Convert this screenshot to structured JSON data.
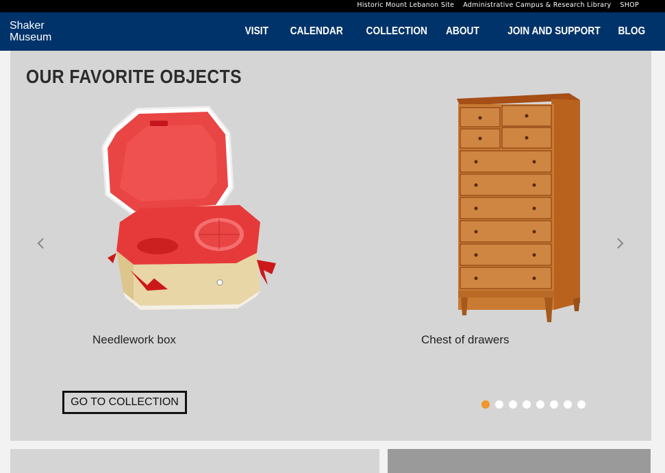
{
  "topbar": {
    "links": [
      "Historic Mount Lebanon Site",
      "Administrative Campus & Research Library",
      "SHOP"
    ]
  },
  "header": {
    "logo_line1": "Shaker",
    "logo_line2": "Museum",
    "nav": [
      "VISIT",
      "CALENDAR",
      "COLLECTION",
      "ABOUT",
      "JOIN AND SUPPORT",
      "BLOG"
    ]
  },
  "feature": {
    "title": "OUR FAVORITE OBJECTS",
    "slides": [
      {
        "caption": "Needlework box",
        "icon": "needlework-box-image"
      },
      {
        "caption": "Chest of drawers",
        "icon": "chest-of-drawers-image"
      }
    ],
    "prev_icon": "chevron-left-icon",
    "next_icon": "chevron-right-icon",
    "button_label": "GO TO COLLECTION",
    "dots_total": 8,
    "dots_active": 1
  },
  "colors": {
    "nav_bg": "#00336a",
    "topbar_bg": "#000000",
    "panel_bg": "#d5d5d5",
    "active_dot": "#f0962a"
  }
}
